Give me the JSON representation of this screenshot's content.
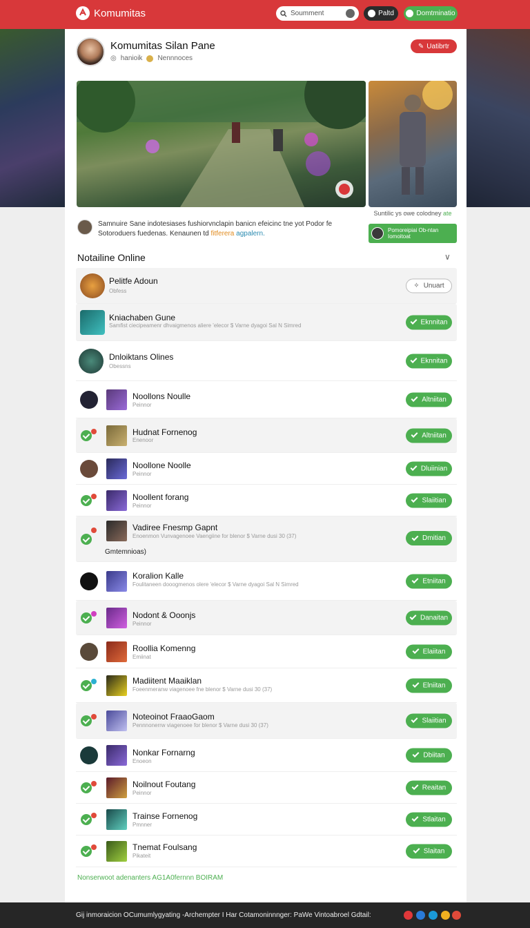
{
  "header": {
    "brand": "Komumitas",
    "search_placeholder": "Soumment",
    "dark_button": "Paltd",
    "green_button": "Domtminatio"
  },
  "profile": {
    "title": "Komumitas Silan Pane",
    "meta_left": "hanioik",
    "meta_right": "Nennnoces",
    "action_button": "Uatibrtr"
  },
  "hero": {
    "side_caption_plain": "Suntilic ys owe colodney",
    "side_caption_highlight": "ate",
    "side_box_text": "Pomoreipiai Ob-ntan Iomoitoat"
  },
  "description": {
    "line1": "Samnuire Sane indotesiases fushiorvnclapin banicn efeicinc tne yot Podor fe",
    "line2_plain": "Sotoroduers fuedenas. Kenaunen td",
    "line2_orange": "fitferera",
    "line2_blue": "agpalern."
  },
  "section": {
    "title": "Notailine Online",
    "chevron": "∨"
  },
  "rows": [
    {
      "name": "Pelitfe Adoun",
      "sub": "Obfess",
      "button": "Unuart"
    },
    {
      "name": "Kniachaben Gune",
      "sub": "Samfist ciecipeamenr dhvaigmenos aliere 'elecor $ Varne dyagoi Sal N Simred",
      "button": "Eknnitan"
    },
    {
      "name": "Dnloiktans Olines",
      "sub": "Obessns",
      "button": "Eknnitan"
    },
    {
      "name": "Noollons Noulle",
      "sub": "Peinnor",
      "button": "Altniitan"
    },
    {
      "name": "Hudnat Fornenog",
      "sub": "Enenoor",
      "button": "Altniitan"
    },
    {
      "name": "Noollone Noolle",
      "sub": "Peinnor",
      "button": "Dluiinian"
    },
    {
      "name": "Noollent forang",
      "sub": "Peinnor",
      "button": "Slaiitian"
    },
    {
      "name": "Vadiree Fnesmp Gapnt",
      "sub": "Enoenmon Vunvagenoee Vaengiine for blenor $ Varne dusi 30 (37)",
      "extra": "Gmtemnioas)",
      "button": "Dmitian"
    },
    {
      "name": "Koralion Kalle",
      "sub": "Foulitaneen dooogmenos olere 'elecor $ Varne dyagoi Sal N Simred",
      "button": "Etniitan"
    },
    {
      "name": "Nodont & Ooonjs",
      "sub": "Peinnor",
      "button": "Danaitan"
    },
    {
      "name": "Roollia Komenng",
      "sub": "Emiinat",
      "button": "Elaiitan"
    },
    {
      "name": "Madiitent Maaiklan",
      "sub": "Foeenmeranw viagenoee fne blenor $ Varne dusi 30 (37)",
      "button": "Elniitan"
    },
    {
      "name": "Noteoinot FraaoGaom",
      "sub": "Pennnonerrw viagenoee for blenor $ Varne dusi 30 (37)",
      "button": "Slaiitian"
    },
    {
      "name": "Nonkar Fornarng",
      "sub": "Enoeon",
      "button": "Dbiitan"
    },
    {
      "name": "Noilnout Foutang",
      "sub": "Peinnor",
      "button": "Reaitan"
    },
    {
      "name": "Trainse Fornenog",
      "sub": "Pmnner",
      "button": "Stlaitan"
    },
    {
      "name": "Tnemat Foulsang",
      "sub": "Pikateit",
      "button": "Slaitan"
    }
  ],
  "footer_link": "Nonserwoot adenanters AG1A0fernnn BOIRAM",
  "bottombar": {
    "text": "Gij inmoraicion  OCumumlygyating -Archempter I Har  Cotamoninnnger: PaWe Vintoabroel Gdtail:"
  },
  "colors": {
    "brand_red": "#d8383a",
    "accent_green": "#4caf50",
    "bottom_bar": "#262626"
  }
}
